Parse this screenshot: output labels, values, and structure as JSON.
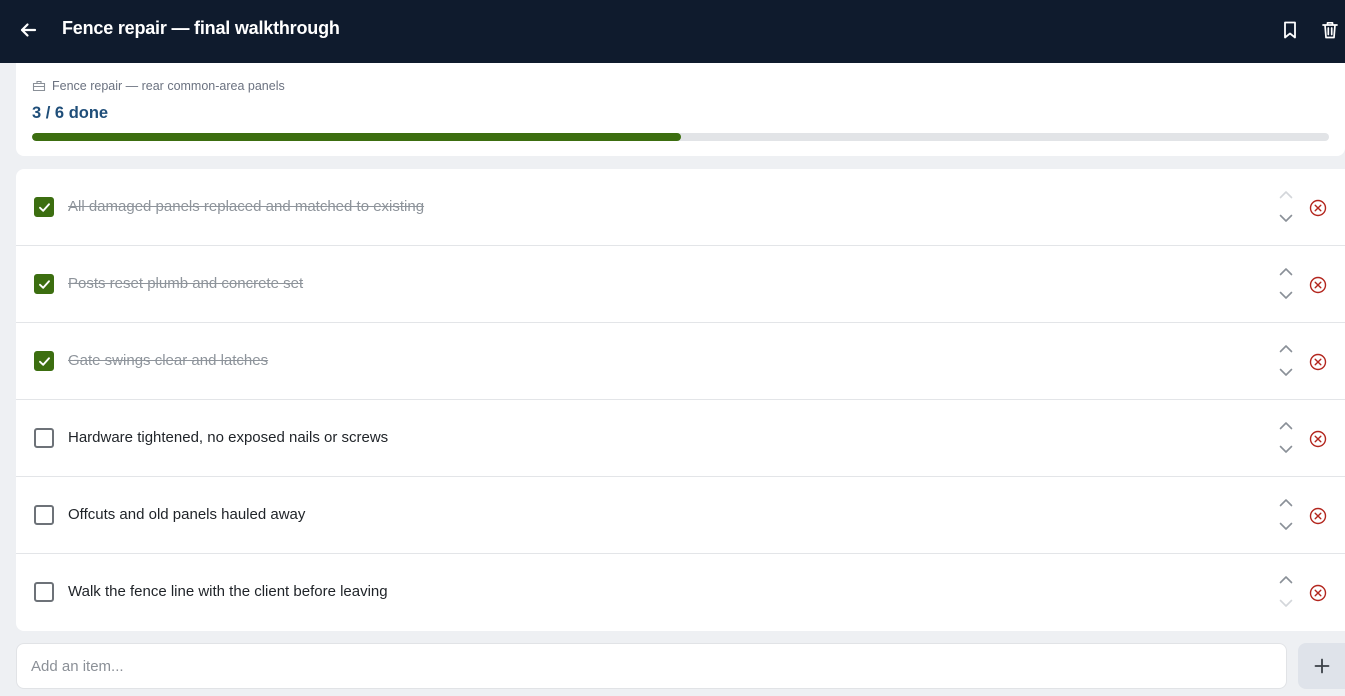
{
  "header": {
    "title": "Fence repair — final walkthrough",
    "icons": [
      "arrow-left-icon",
      "bookmark-icon",
      "trash-icon"
    ]
  },
  "summary": {
    "project": "Fence repair — rear common-area panels",
    "progress_label": "3 / 6 done",
    "progress_fraction": 0.5
  },
  "items": [
    {
      "label": "All damaged panels replaced and matched to existing",
      "done": true
    },
    {
      "label": "Posts reset plumb and concrete set",
      "done": true
    },
    {
      "label": "Gate swings clear and latches",
      "done": true
    },
    {
      "label": "Hardware tightened, no exposed nails or screws",
      "done": false
    },
    {
      "label": "Offcuts and old panels hauled away",
      "done": false
    },
    {
      "label": "Walk the fence line with the client before leaving",
      "done": false
    }
  ],
  "composer": {
    "placeholder": "Add an item..."
  },
  "colors": {
    "header_bg": "#0f1b2d",
    "accent_green": "#3c6e10",
    "progress_text": "#1f4e79",
    "remove_red": "#b3261e"
  }
}
